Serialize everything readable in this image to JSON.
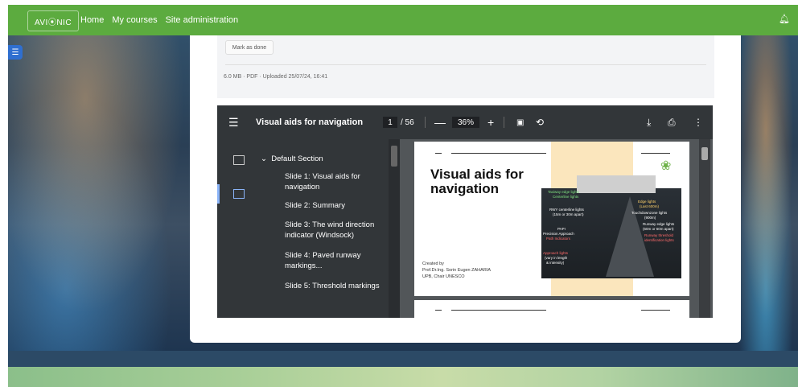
{
  "navbar": {
    "logo_text": "AVI⦿NIC",
    "links": [
      "Home",
      "My courses",
      "Site administration"
    ],
    "notification_icon": "bell-icon",
    "brand_color": "#5cab3f"
  },
  "activity": {
    "mark_done_label": "Mark as done",
    "file_meta": "6.0 MB · PDF · Uploaded 25/07/24, 16:41"
  },
  "pdf_viewer": {
    "document_title": "Visual aids for navigation",
    "current_page": "1",
    "total_pages": "/ 56",
    "zoom": "36%",
    "icons": [
      "menu-icon",
      "zoom-out-icon",
      "zoom-in-icon",
      "fit-page-icon",
      "rotate-icon",
      "download-icon",
      "print-icon",
      "more-icon"
    ],
    "outline": {
      "section": "Default Section",
      "items": [
        "Slide 1: Visual aids for navigation",
        "Slide 2: Summary",
        "Slide 3: The wind direction indicator (Windsock)",
        "Slide 4: Paved runway markings...",
        "Slide 5: Threshold markings"
      ]
    },
    "slide": {
      "title": "Visual aids for navigation",
      "created_by": "Created by",
      "author": "Prof.Dr.Ing. Sorin Eugen ZAHARIA",
      "affiliation": "UPB, Chair UNESCO",
      "photo_labels": [
        "Taxiway edge lights",
        "Centerline lights",
        "Edge lights",
        "(Last 600m)",
        "RWY centerline lights",
        "(15m or 30m apart)",
        "Touchdownzone lights",
        "(900m)",
        "Runway edge lights",
        "(60m or 60m apart)",
        "Runway threshold",
        "identification lights",
        "PAPI",
        "Precision Approach",
        "Path Indicators",
        "Approach lights",
        "(vary in length",
        "& intensity)"
      ]
    }
  }
}
